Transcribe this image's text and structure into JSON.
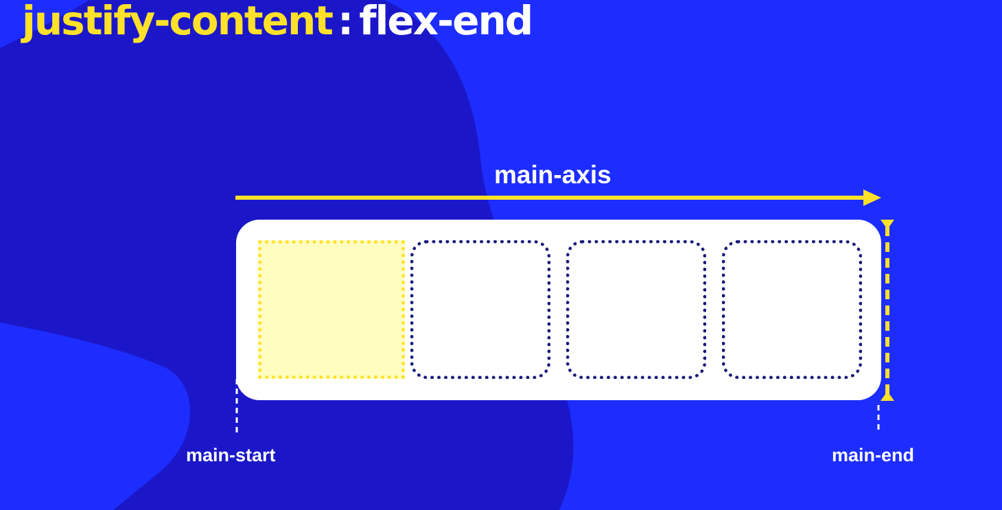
{
  "title": {
    "property": "justify-content",
    "separator": ":",
    "value": "flex-end"
  },
  "labels": {
    "main_axis": "main-axis",
    "main_start": "main-start",
    "main_end": "main-end"
  },
  "colors": {
    "background_dark": "#1b17c9",
    "background_light": "#1d2dff",
    "accent_yellow": "#ffe12a",
    "highlight_fill": "#fffdc0",
    "item_border": "#1a1a7a",
    "container": "#ffffff"
  },
  "items": [
    {
      "state": "highlighted"
    },
    {
      "state": "dotted"
    },
    {
      "state": "dotted"
    },
    {
      "state": "dotted"
    }
  ]
}
